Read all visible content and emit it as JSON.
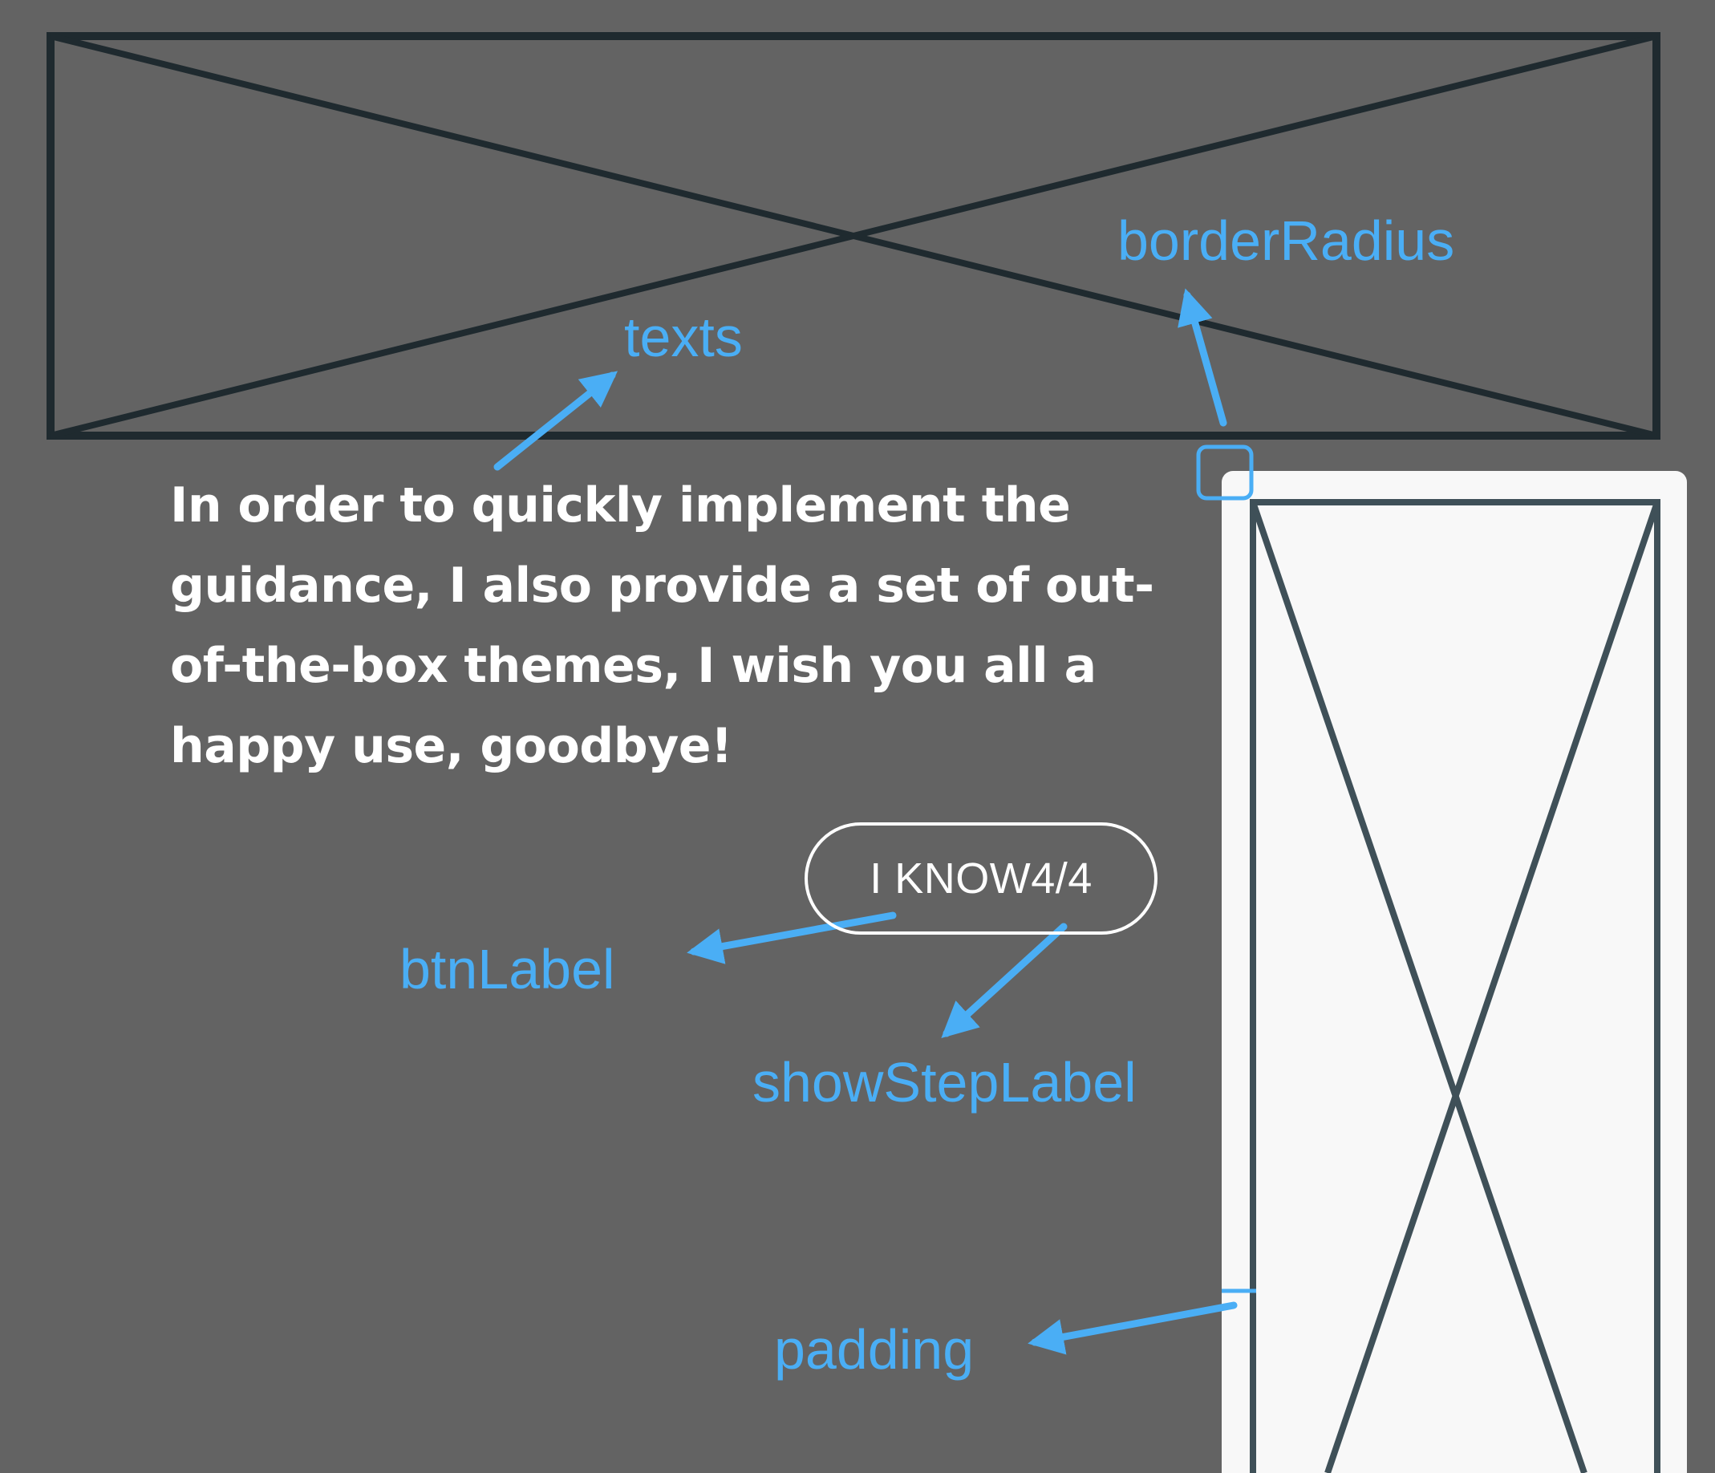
{
  "guide": {
    "texts": "In order to quickly implement the guidance, I also provide a set of out-of-the-box themes, I wish you all a happy use, goodbye!",
    "button_label": "I KNOW",
    "step_label": "4/4"
  },
  "annotations": {
    "texts": "texts",
    "border_radius": "borderRadius",
    "btn_label": "btnLabel",
    "show_step_label": "showStepLabel",
    "padding": "padding"
  },
  "colors": {
    "background": "#636363",
    "annotation": "#4aaef5",
    "placeholder_stroke": "#1f2a2f",
    "card_fill": "#f8f8f8",
    "card_stroke": "#3f5058"
  }
}
